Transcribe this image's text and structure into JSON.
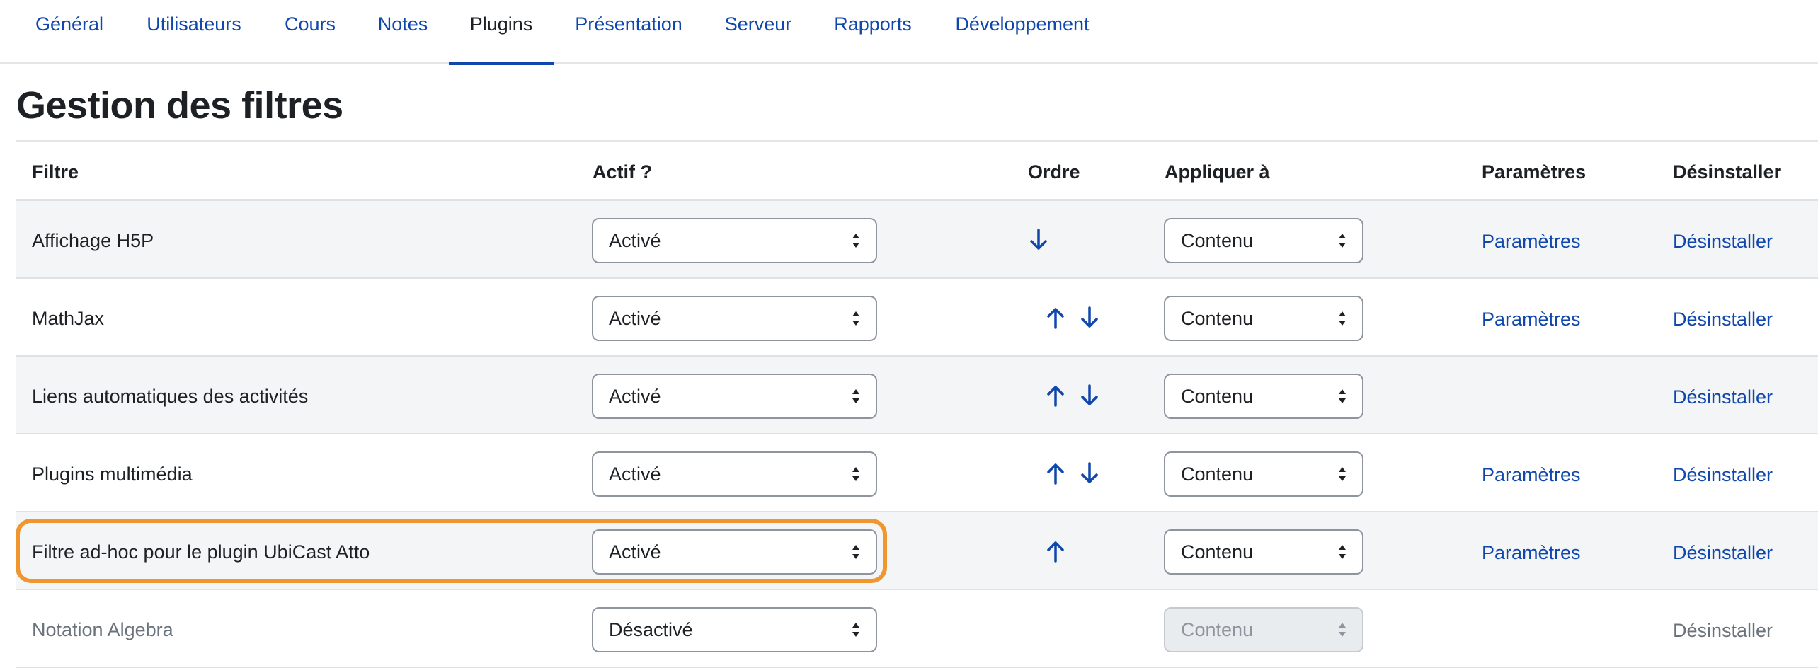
{
  "tabs": [
    {
      "label": "Général"
    },
    {
      "label": "Utilisateurs"
    },
    {
      "label": "Cours"
    },
    {
      "label": "Notes"
    },
    {
      "label": "Plugins",
      "active": true
    },
    {
      "label": "Présentation"
    },
    {
      "label": "Serveur"
    },
    {
      "label": "Rapports"
    },
    {
      "label": "Développement"
    }
  ],
  "page": {
    "title": "Gestion des filtres"
  },
  "table": {
    "headers": {
      "filter": "Filtre",
      "active": "Actif ?",
      "order": "Ordre",
      "apply": "Appliquer à",
      "settings": "Paramètres",
      "uninstall": "Désinstaller"
    },
    "rows": [
      {
        "name": "Affichage H5P",
        "active": "Activé",
        "apply": "Contenu",
        "settings": "Paramètres",
        "uninstall": "Désinstaller"
      },
      {
        "name": "MathJax",
        "active": "Activé",
        "apply": "Contenu",
        "settings": "Paramètres",
        "uninstall": "Désinstaller"
      },
      {
        "name": "Liens automatiques des activités",
        "active": "Activé",
        "apply": "Contenu",
        "settings": "",
        "uninstall": "Désinstaller"
      },
      {
        "name": "Plugins multimédia",
        "active": "Activé",
        "apply": "Contenu",
        "settings": "Paramètres",
        "uninstall": "Désinstaller"
      },
      {
        "name": "Filtre ad-hoc pour le plugin UbiCast Atto",
        "active": "Activé",
        "apply": "Contenu",
        "settings": "Paramètres",
        "uninstall": "Désinstaller"
      },
      {
        "name": "Notation Algebra",
        "active": "Désactivé",
        "apply": "Contenu",
        "settings": "",
        "uninstall": "Désinstaller"
      }
    ]
  },
  "icons": {
    "move_up": "arrow-up-icon",
    "move_down": "arrow-down-icon",
    "select_caret": "sort-caret-icon"
  },
  "colors": {
    "link": "#0f47ad",
    "highlight": "#f0962e",
    "muted": "#6a737b"
  }
}
